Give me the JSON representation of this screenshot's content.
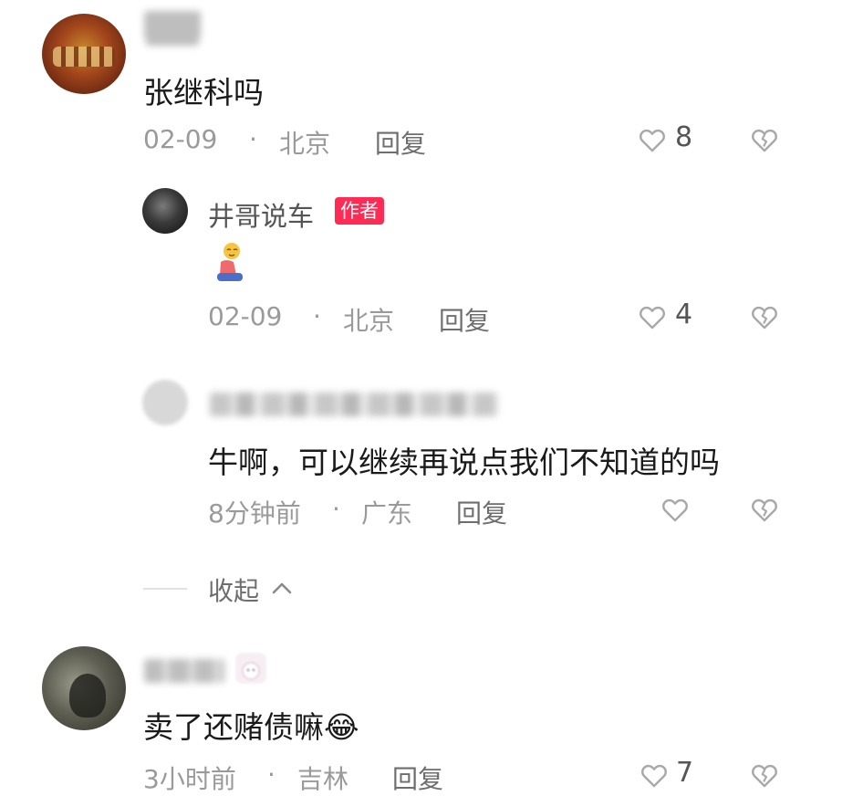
{
  "colors": {
    "accent": "#fe2c55",
    "meta": "#9a9a9a",
    "icon": "#b0b0b0"
  },
  "comments": [
    {
      "text": "张继科吗",
      "date": "02-09",
      "location": "北京",
      "reply_label": "回复",
      "likes": "8",
      "dislike_icon": "broken-heart-icon"
    },
    {
      "author": "井哥说车",
      "author_tag": "作者",
      "text": "🧎",
      "date": "02-09",
      "location": "北京",
      "reply_label": "回复",
      "likes": "4"
    },
    {
      "text": "牛啊，可以继续再说点我们不知道的吗",
      "date": "8分钟前",
      "location": "广东",
      "reply_label": "回复",
      "likes": ""
    },
    {
      "collapse_label": "收起"
    },
    {
      "text": "卖了还赌债嘛😂",
      "date": "3小时前",
      "location": "吉林",
      "reply_label": "回复",
      "likes": "7"
    }
  ],
  "separator": "·"
}
